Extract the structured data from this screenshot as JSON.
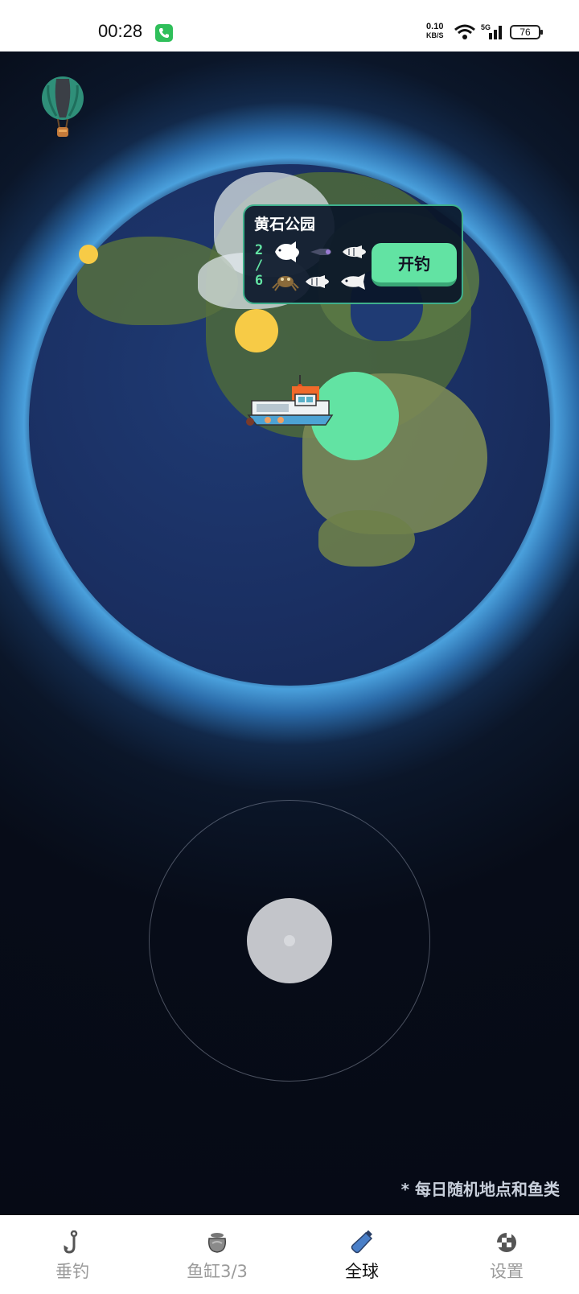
{
  "status_bar": {
    "time": "00:28",
    "net_speed_value": "0.10",
    "net_speed_unit": "KB/S",
    "network": "5G",
    "battery": "76"
  },
  "popup": {
    "title": "黄石公园",
    "progress_caught": "2",
    "progress_sep": "/",
    "progress_total": "6",
    "start_button": "开钓"
  },
  "footnote": "* 每日随机地点和鱼类",
  "tabs": [
    {
      "label": "垂钓",
      "icon": "fishing-hook-icon",
      "active": false
    },
    {
      "label": "鱼缸3/3",
      "icon": "fish-tank-icon",
      "active": false
    },
    {
      "label": "全球",
      "icon": "bottle-icon",
      "active": true
    },
    {
      "label": "设置",
      "icon": "settings-icon",
      "active": false
    }
  ],
  "colors": {
    "accent_green": "#62e3a3",
    "marker_yellow": "#f7cb46"
  }
}
